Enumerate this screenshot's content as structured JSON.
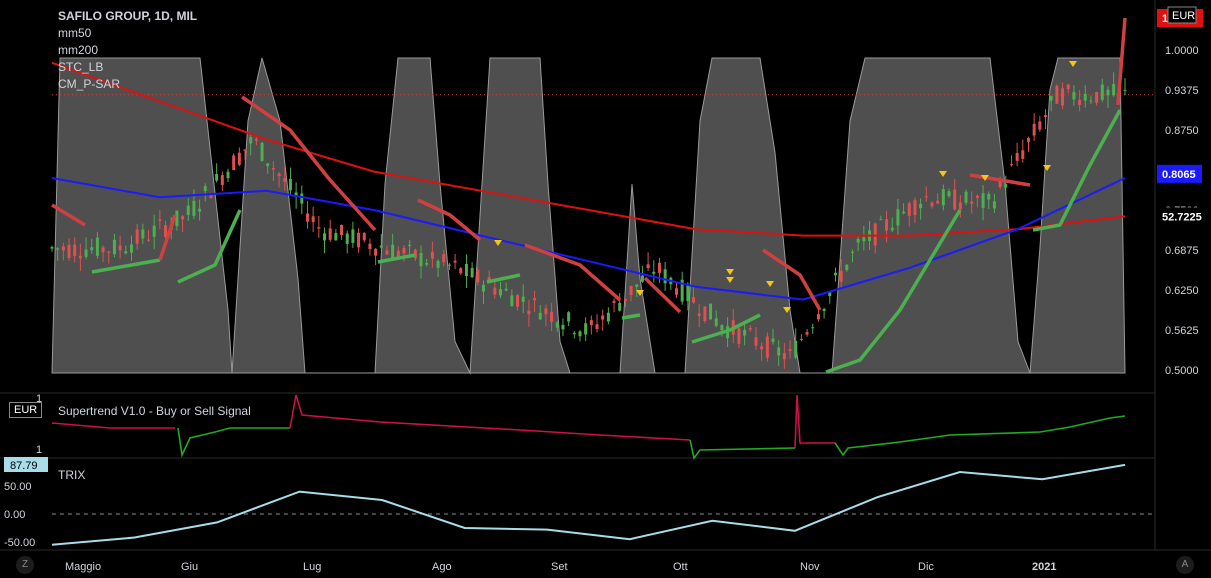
{
  "main": {
    "title": "SAFILO GROUP, 1D, MIL",
    "indicators": [
      "mm50",
      "mm200",
      "STC_LB",
      "CM_P-SAR"
    ],
    "currency": "EUR"
  },
  "supertrend": {
    "label": "Supertrend V1.0 - Buy or Sell Signal",
    "currency": "EUR",
    "axis_labels": [
      "1",
      "1"
    ]
  },
  "trix": {
    "label": "TRIX",
    "value_badge": "87.79"
  },
  "x_axis": [
    "Maggio",
    "Giu",
    "Lug",
    "Ago",
    "Set",
    "Ott",
    "Nov",
    "Dic",
    "2021"
  ],
  "buttons": {
    "left": "Z",
    "right": "A"
  },
  "colors": {
    "mm50": "#1a1aff",
    "mm200": "#e01010",
    "stc": "#8c8c8c",
    "sar_bull": "#4caf50",
    "sar_bear": "#d04040",
    "candle_up": "#4caf50",
    "candle_down": "#e05050",
    "trix": "#a8dce8",
    "supertrend_bull": "#22aa22",
    "supertrend_bear": "#cc1144"
  },
  "chart_data": [
    {
      "type": "line",
      "title": "SAFILO GROUP, 1D, MIL",
      "x": [
        "Maggio",
        "Giu",
        "Lug",
        "Ago",
        "Set",
        "Ott",
        "Nov",
        "Dic",
        "2021"
      ],
      "y_ticks": [
        "1.0000",
        "0.9375",
        "0.8750",
        "0.8065",
        "0.7500",
        "0.6875",
        "0.6250",
        "0.5625",
        "0.5000"
      ],
      "ylim": [
        0.5,
        1.04
      ],
      "last_price": "0.8065",
      "stc_value": "52.7225",
      "series": [
        {
          "name": "mm50",
          "values": [
            0.8,
            0.77,
            0.78,
            0.75,
            0.71,
            0.67,
            0.63,
            0.61,
            0.66,
            0.72,
            0.8
          ]
        },
        {
          "name": "mm200",
          "values": [
            0.98,
            0.92,
            0.86,
            0.81,
            0.78,
            0.75,
            0.72,
            0.71,
            0.71,
            0.72,
            0.74
          ]
        },
        {
          "name": "close",
          "values": [
            0.69,
            0.69,
            0.74,
            0.86,
            0.72,
            0.69,
            0.66,
            0.61,
            0.56,
            0.66,
            0.57,
            0.52,
            0.69,
            0.77,
            0.76,
            0.93,
            0.93
          ]
        }
      ]
    },
    {
      "type": "line",
      "title": "TRIX",
      "y_ticks": [
        "50.00",
        "0.00",
        "-50.00"
      ],
      "ylim": [
        -60,
        90
      ],
      "series": [
        {
          "name": "TRIX",
          "values": [
            -55,
            -42,
            -15,
            40,
            25,
            -25,
            -28,
            -45,
            -12,
            -30,
            30,
            75,
            62,
            87.79
          ]
        }
      ]
    }
  ]
}
